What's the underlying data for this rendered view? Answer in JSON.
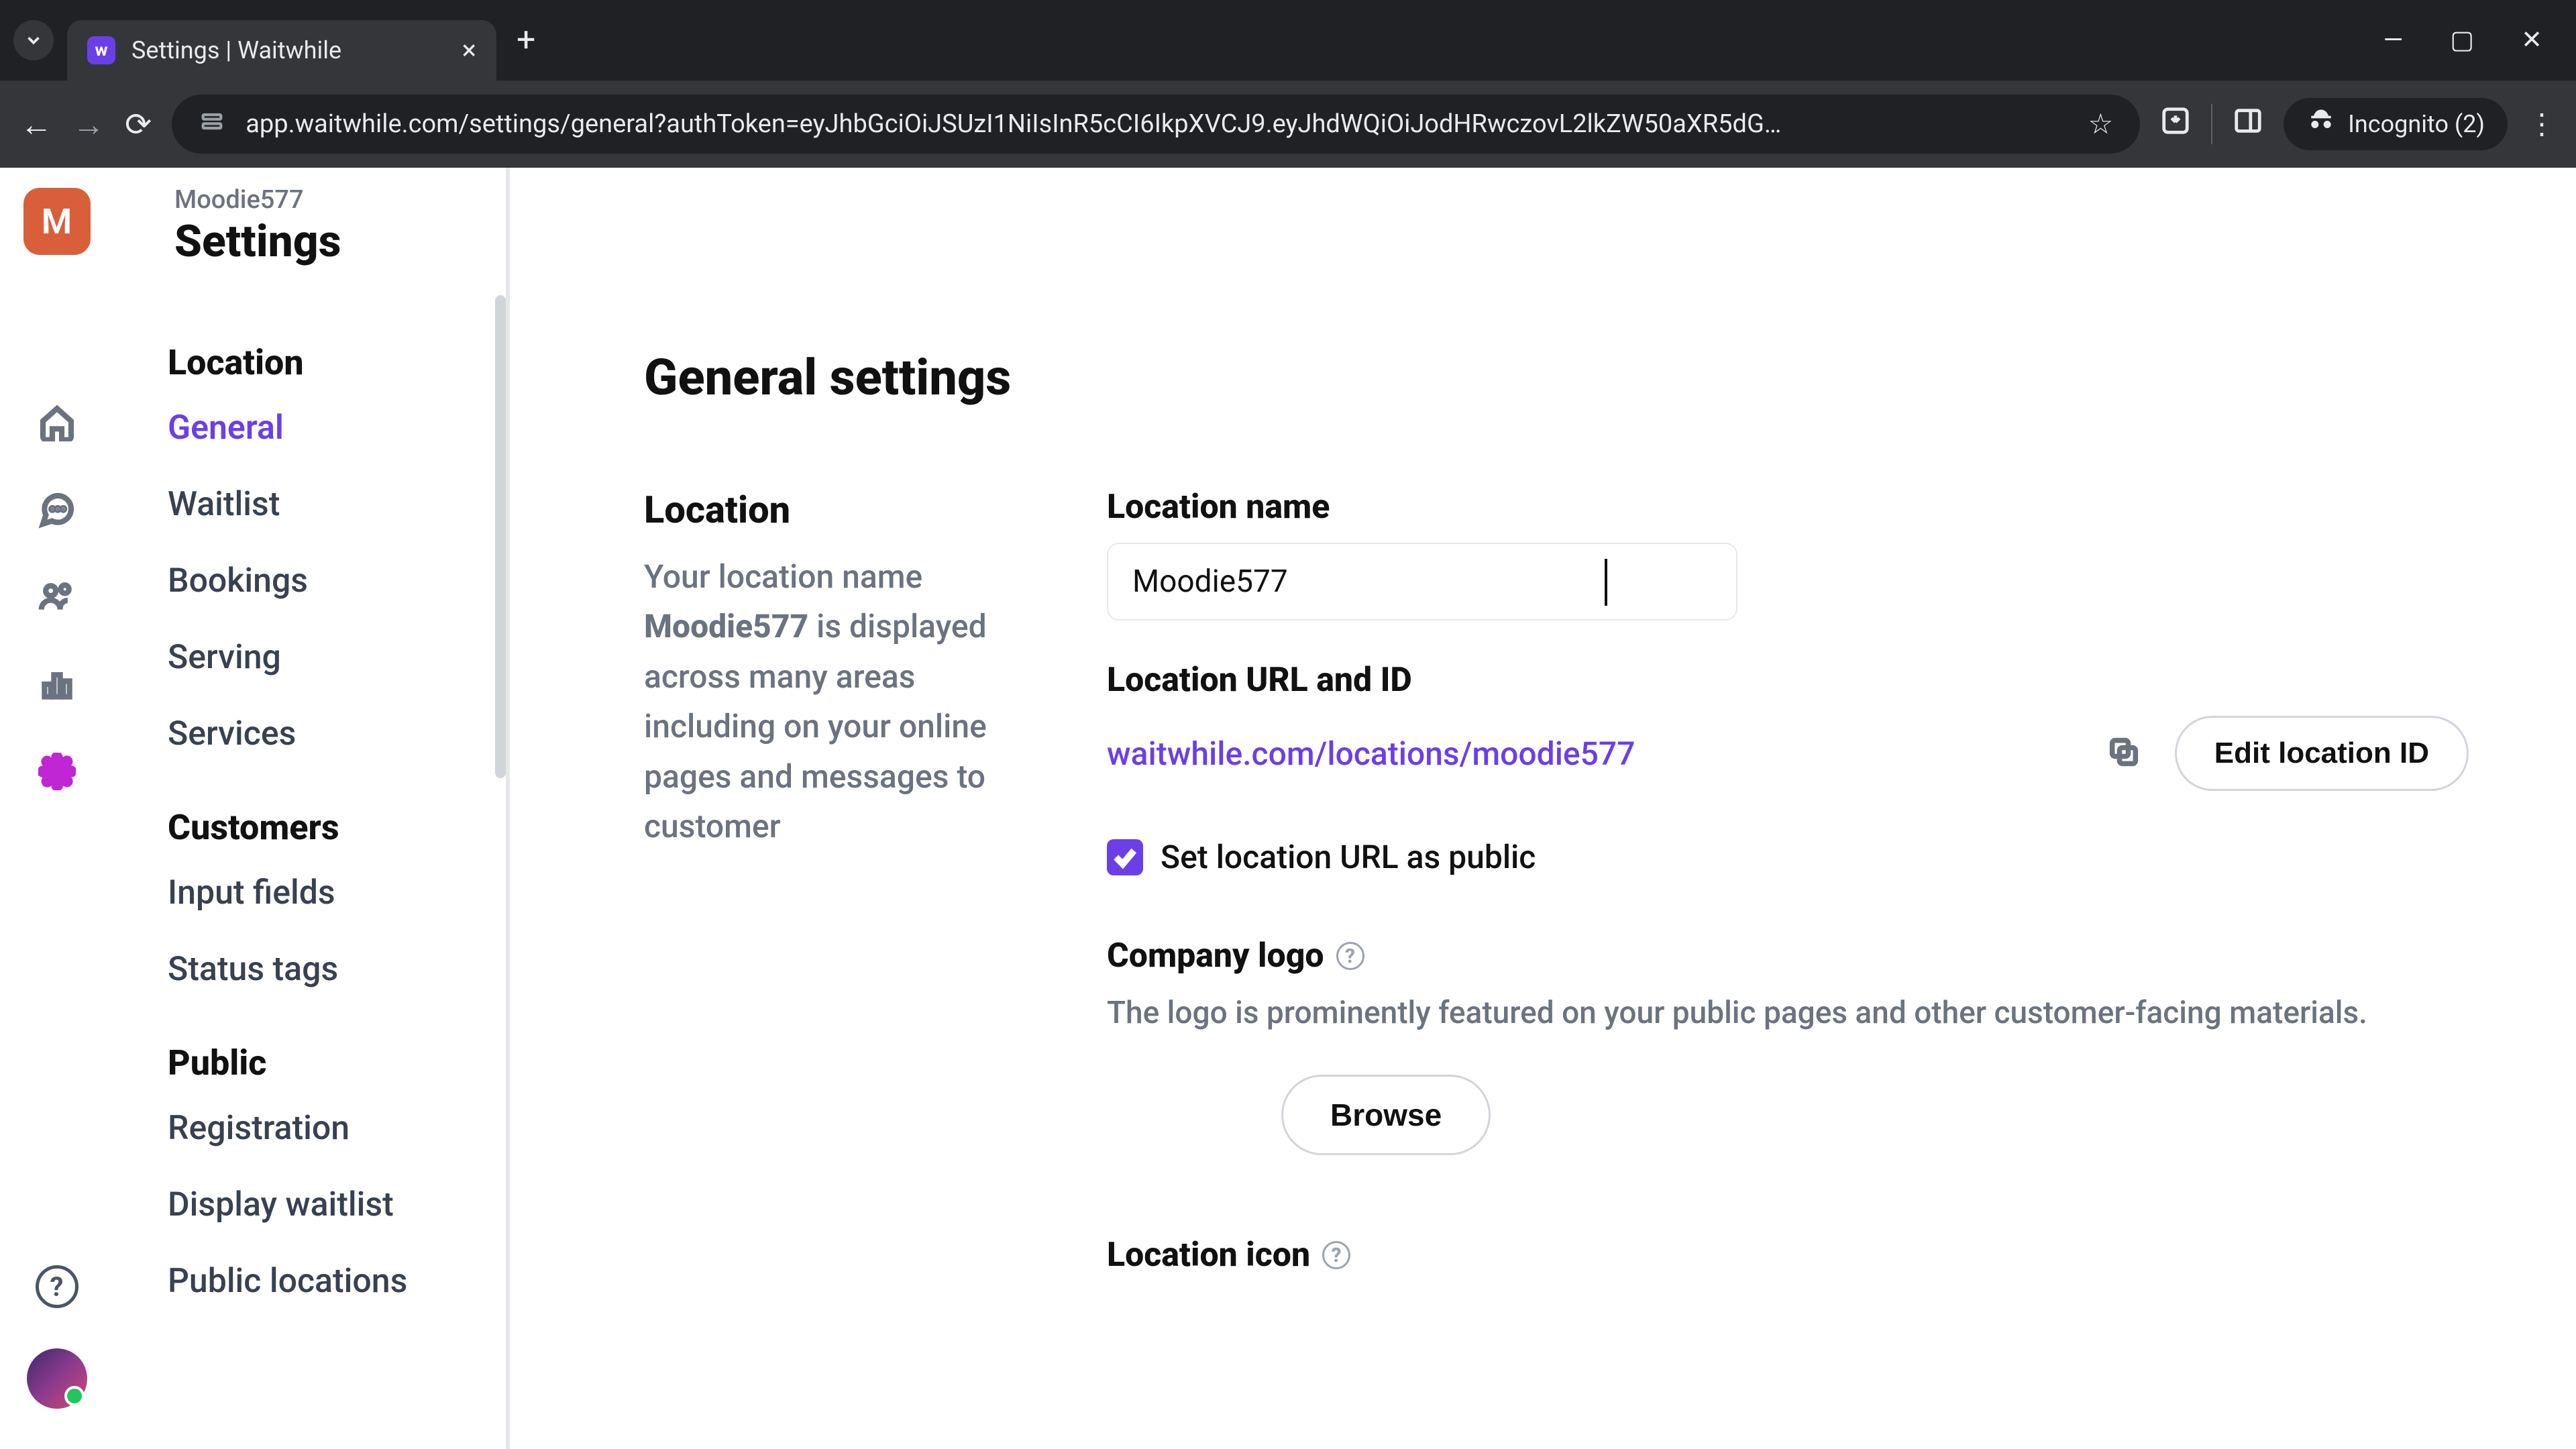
{
  "browser": {
    "tab_title": "Settings | Waitwhile",
    "url": "app.waitwhile.com/settings/general?authToken=eyJhbGciOiJSUzI1NiIsInR5cCI6IkpXVCJ9.eyJhdWQiOiJodHRwczovL2lkZW50aXR5dG…",
    "incognito_label": "Incognito (2)"
  },
  "header": {
    "org": "Moodie577",
    "title": "Settings",
    "avatar_letter": "M"
  },
  "sidebar": {
    "groups": [
      {
        "title": "Location",
        "items": [
          "General",
          "Waitlist",
          "Bookings",
          "Serving",
          "Services"
        ],
        "active": "General"
      },
      {
        "title": "Customers",
        "items": [
          "Input fields",
          "Status tags"
        ]
      },
      {
        "title": "Public",
        "items": [
          "Registration",
          "Display waitlist",
          "Public locations"
        ]
      }
    ]
  },
  "main": {
    "page_title": "General settings",
    "section_title": "Location",
    "section_desc_pre": "Your location name ",
    "section_desc_bold": "Moodie577",
    "section_desc_post": " is displayed across many areas including on your online pages and messages to customer",
    "loc_name_label": "Location name",
    "loc_name_value": "Moodie577",
    "loc_url_label": "Location URL and ID",
    "loc_url_value": "waitwhile.com/locations/moodie577",
    "edit_id_label": "Edit location ID",
    "chk_public_label": "Set location URL as public",
    "logo_label": "Company logo",
    "logo_desc": "The logo is prominently featured on your public pages and other customer-facing materials.",
    "browse_label": "Browse",
    "icon_label": "Location icon"
  }
}
